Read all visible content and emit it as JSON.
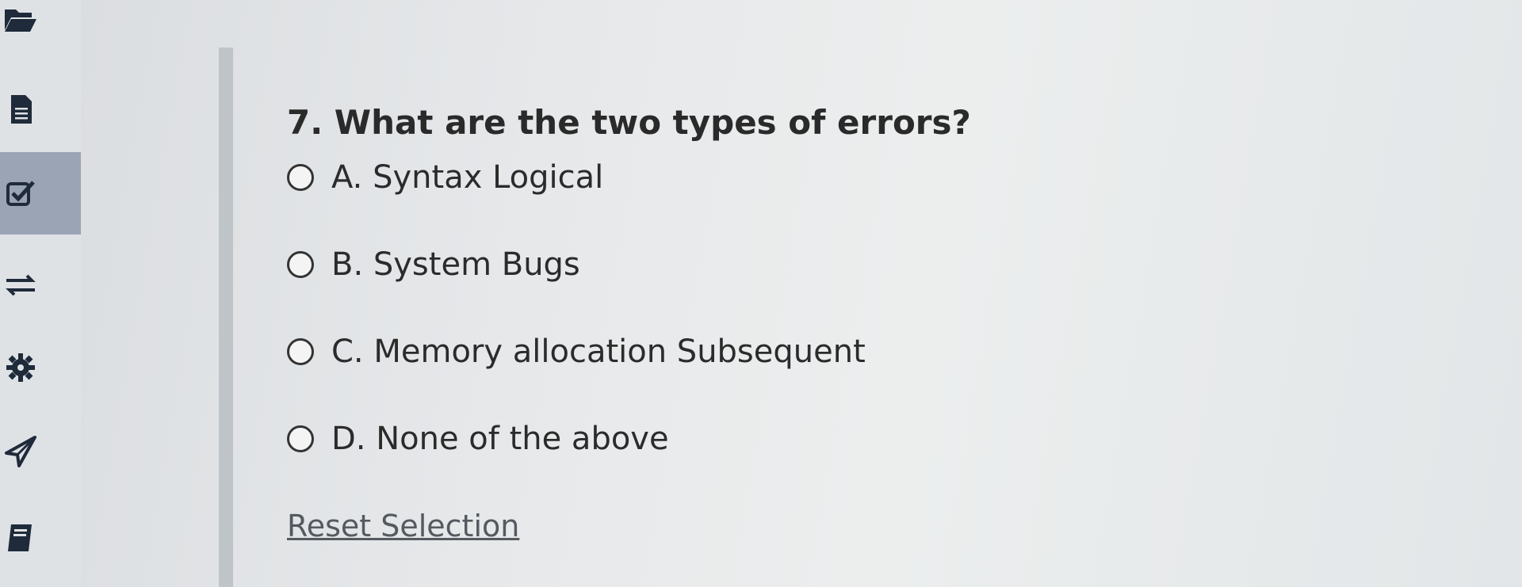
{
  "sidebar": {
    "items": [
      {
        "icon": "folder-open-icon"
      },
      {
        "icon": "document-icon"
      },
      {
        "icon": "checkbox-icon",
        "active": true
      },
      {
        "icon": "swap-arrows-icon"
      },
      {
        "icon": "gear-icon"
      },
      {
        "icon": "send-icon"
      },
      {
        "icon": "notebook-icon"
      }
    ],
    "active_color": "#9aa4b4"
  },
  "question": {
    "title": "7. What are the two types of errors?",
    "options": [
      {
        "label": "A. Syntax Logical"
      },
      {
        "label": "B. System Bugs"
      },
      {
        "label": "C. Memory allocation Subsequent"
      },
      {
        "label": "D. None of the above"
      }
    ],
    "reset_label": "Reset Selection"
  }
}
